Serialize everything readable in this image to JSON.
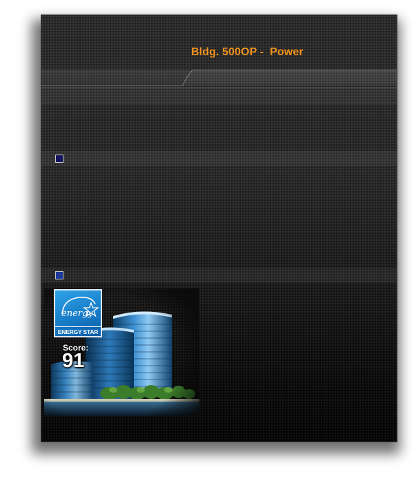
{
  "header": {
    "title": "Bldg. 500OP -  Power"
  },
  "energy_star": {
    "logo_script": "energy",
    "label": "ENERGY STAR",
    "score_label": "Score:",
    "score_value": "91"
  },
  "colors": {
    "title": "#f0921c",
    "square_1": "#15155e",
    "square_2": "#1c3a9a",
    "badge_blue": "#1779c4"
  }
}
